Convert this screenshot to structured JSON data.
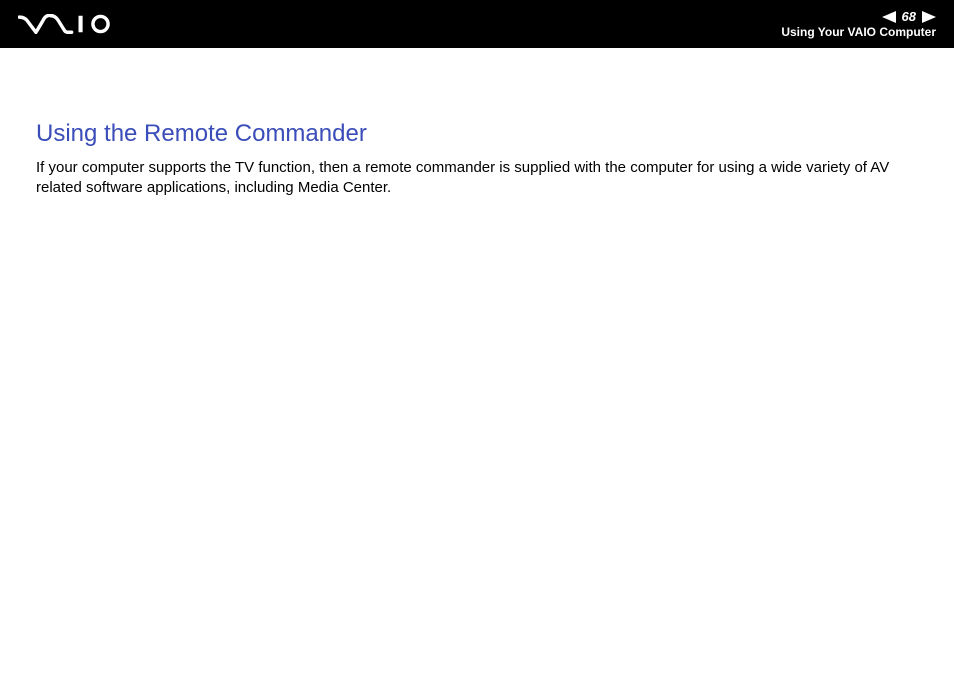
{
  "header": {
    "page_number": "68",
    "section_name": "Using Your VAIO Computer"
  },
  "content": {
    "heading": "Using the Remote Commander",
    "body": "If your computer supports the TV function, then a remote commander is supplied with the computer for using a wide variety of AV related software applications, including Media Center."
  }
}
